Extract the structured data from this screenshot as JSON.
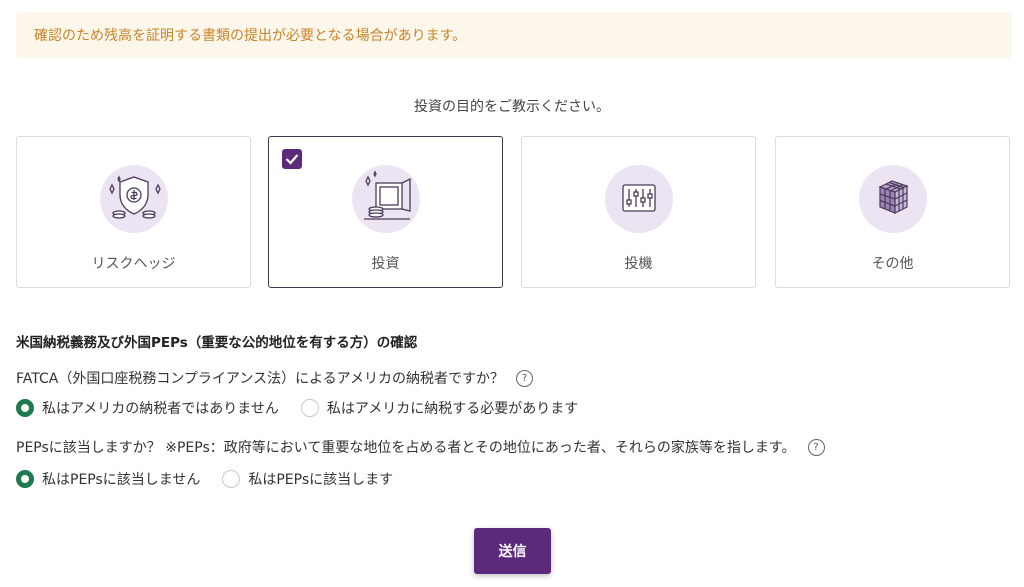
{
  "notice": {
    "text": "確認のため残高を証明する書類の提出が必要となる場合があります。"
  },
  "purpose": {
    "title": "投資の目的をご教示ください。",
    "options": [
      {
        "label": "リスクヘッジ",
        "icon": "shield-coins-icon",
        "selected": false
      },
      {
        "label": "投資",
        "icon": "safe-coins-icon",
        "selected": true
      },
      {
        "label": "投機",
        "icon": "sliders-icon",
        "selected": false
      },
      {
        "label": "その他",
        "icon": "cube-icon",
        "selected": false
      }
    ]
  },
  "compliance": {
    "title": "米国納税義務及び外国PEPs（重要な公的地位を有する方）の確認",
    "fatca": {
      "question": "FATCA（外国口座税務コンプライアンス法）によるアメリカの納税者ですか？",
      "options": [
        {
          "label": "私はアメリカの納税者ではありません",
          "selected": true
        },
        {
          "label": "私はアメリカに納税する必要があります",
          "selected": false
        }
      ]
    },
    "peps": {
      "question": "PEPsに該当しますか？ ※PEPs：政府等において重要な地位を占める者とその地位にあった者、それらの家族等を指します。",
      "options": [
        {
          "label": "私はPEPsに該当しません",
          "selected": true
        },
        {
          "label": "私はPEPsに該当します",
          "selected": false
        }
      ]
    },
    "help_glyph": "?"
  },
  "submit": {
    "label": "送信"
  },
  "colors": {
    "accent": "#5b2a7a",
    "radio_on": "#1f7a4e",
    "notice_bg": "#fdf6ea",
    "notice_text": "#c9852a"
  }
}
